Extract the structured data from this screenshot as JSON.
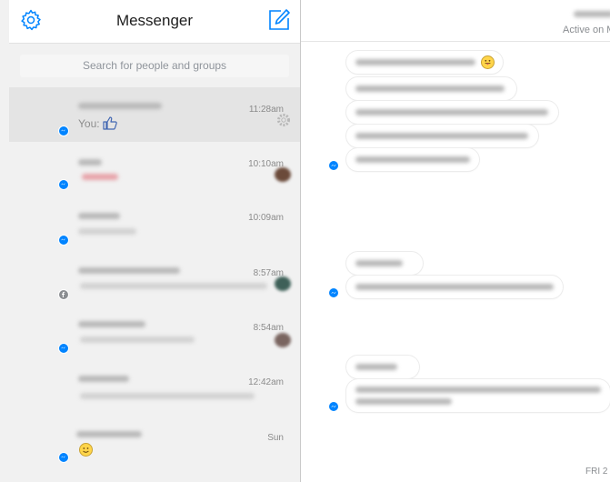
{
  "app": {
    "title": "Messenger",
    "search_placeholder": "Search for people and groups"
  },
  "conversations": [
    {
      "time": "11:28am",
      "preview": "You:",
      "selected": true
    },
    {
      "time": "10:10am"
    },
    {
      "time": "10:09am"
    },
    {
      "time": "8:57am"
    },
    {
      "time": "8:54am"
    },
    {
      "time": "12:42am"
    },
    {
      "time": "Sun"
    }
  ],
  "chat": {
    "status": "Active on M",
    "datestamp": "FRI 2"
  },
  "colors": {
    "accent": "#0084ff",
    "selected_row": "#e4e4e4",
    "sidebar_bg": "#f1f1f1"
  },
  "icons": [
    "gear-icon",
    "compose-icon",
    "thumbs-up-icon",
    "messenger-icon",
    "facebook-icon",
    "emoji-icon"
  ]
}
